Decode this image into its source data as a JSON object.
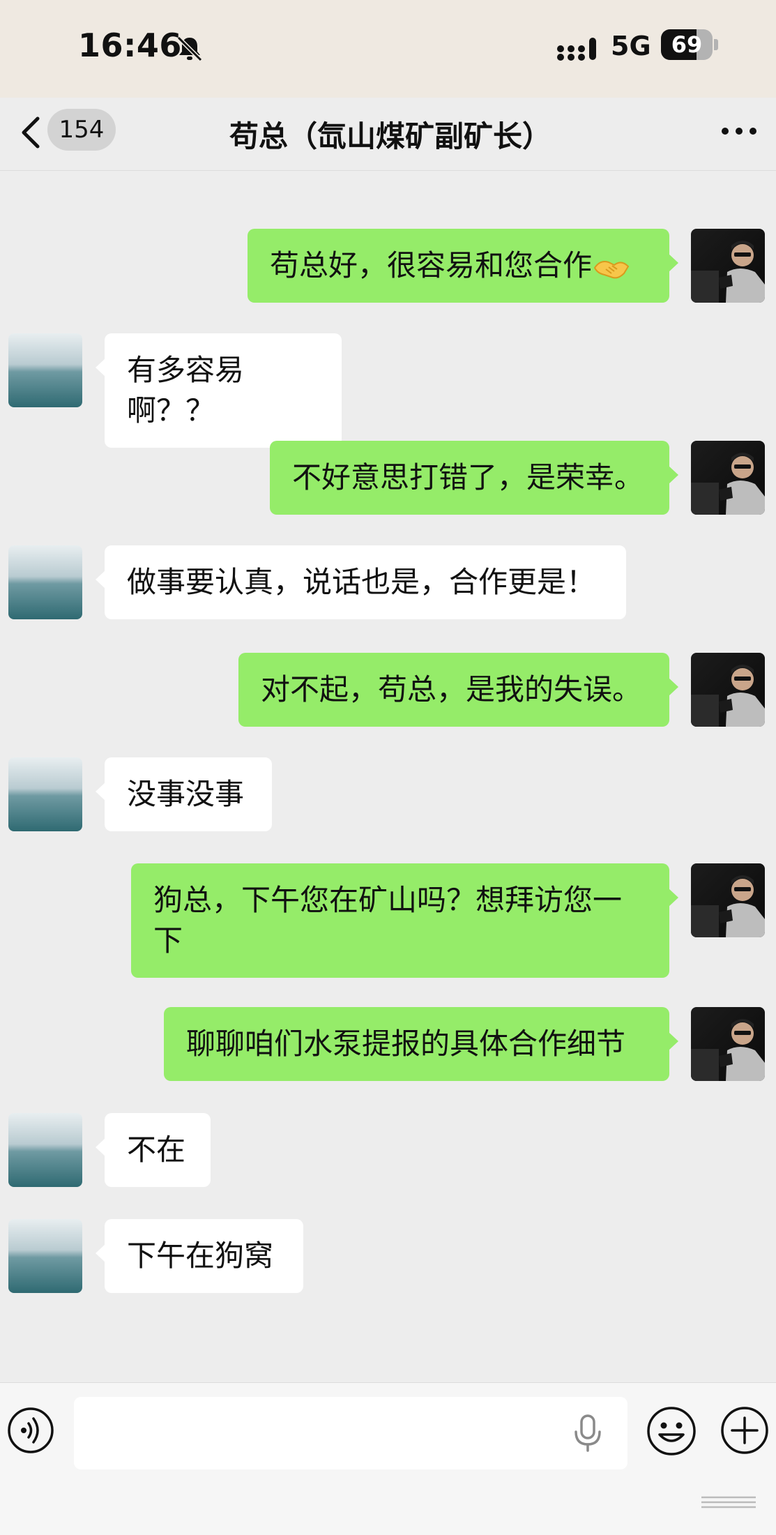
{
  "status_bar": {
    "time": "16:46",
    "network": "5G",
    "battery_level": "69",
    "battery_percent": 69,
    "muted_icon": "bell-slash-icon",
    "signal_icon": "signal-bars-icon"
  },
  "header": {
    "unread_count": "154",
    "title": "苟总（氙山煤矿副矿长）",
    "back_icon": "chevron-left-icon",
    "more_icon": "more-dots-icon"
  },
  "messages": [
    {
      "side": "out",
      "text": "苟总好，很容易和您合作",
      "emoji": "handshake-emoji"
    },
    {
      "side": "in",
      "text": "有多容易啊？？"
    },
    {
      "side": "out",
      "text": "不好意思打错了，是荣幸。"
    },
    {
      "side": "in",
      "text": "做事要认真，说话也是，合作更是！"
    },
    {
      "side": "out",
      "text": "对不起，苟总，是我的失误。"
    },
    {
      "side": "in",
      "text": "没事没事"
    },
    {
      "side": "out",
      "text": "狗总，下午您在矿山吗？想拜访您一下"
    },
    {
      "side": "out",
      "text": "聊聊咱们水泵提报的具体合作细节"
    },
    {
      "side": "in",
      "text": "不在"
    },
    {
      "side": "in",
      "text": "下午在狗窝"
    }
  ],
  "input_bar": {
    "placeholder": "",
    "voice_icon": "voice-mode-icon",
    "mic_icon": "microphone-icon",
    "emoji_icon": "emoji-face-icon",
    "plus_icon": "plus-circle-icon"
  },
  "colors": {
    "outgoing_bubble": "#95ec69",
    "incoming_bubble": "#ffffff",
    "chat_background": "#ededed",
    "status_bar_background": "#efe9e1"
  }
}
